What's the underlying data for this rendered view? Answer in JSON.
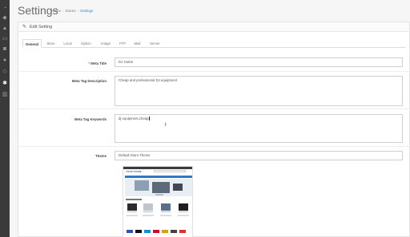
{
  "sidebar": {
    "icons": [
      {
        "name": "dashboard-icon",
        "glyph": "◔"
      },
      {
        "name": "tag-icon",
        "glyph": "◆"
      },
      {
        "name": "puzzle-icon",
        "glyph": "▲"
      },
      {
        "name": "monitor-icon",
        "glyph": "▭"
      },
      {
        "name": "cart-icon",
        "glyph": "◙"
      },
      {
        "name": "user-icon",
        "glyph": "●"
      },
      {
        "name": "share-icon",
        "glyph": "◇"
      },
      {
        "name": "cog-icon",
        "glyph": "✱"
      },
      {
        "name": "chart-icon",
        "glyph": "▥"
      }
    ]
  },
  "header": {
    "title": "Settings",
    "breadcrumb": [
      "Home",
      "Stores",
      "Settings"
    ]
  },
  "panel": {
    "heading": "Edit Setting",
    "tabs": [
      "General",
      "Store",
      "Local",
      "Option",
      "Image",
      "FTP",
      "Mail",
      "Server"
    ]
  },
  "form": {
    "meta_title": {
      "label": "Meta Title",
      "value": "DJ Guitar"
    },
    "meta_description": {
      "label": "Meta Tag Description",
      "value": "Cheap and professional DJ equipment"
    },
    "meta_keywords": {
      "label": "Meta Tag Keywords",
      "value": "dj equipment,cheap"
    },
    "theme": {
      "label": "Theme",
      "value": "Default Store Theme"
    }
  },
  "theme_preview": {
    "logo_text": "YOUR STORE"
  }
}
